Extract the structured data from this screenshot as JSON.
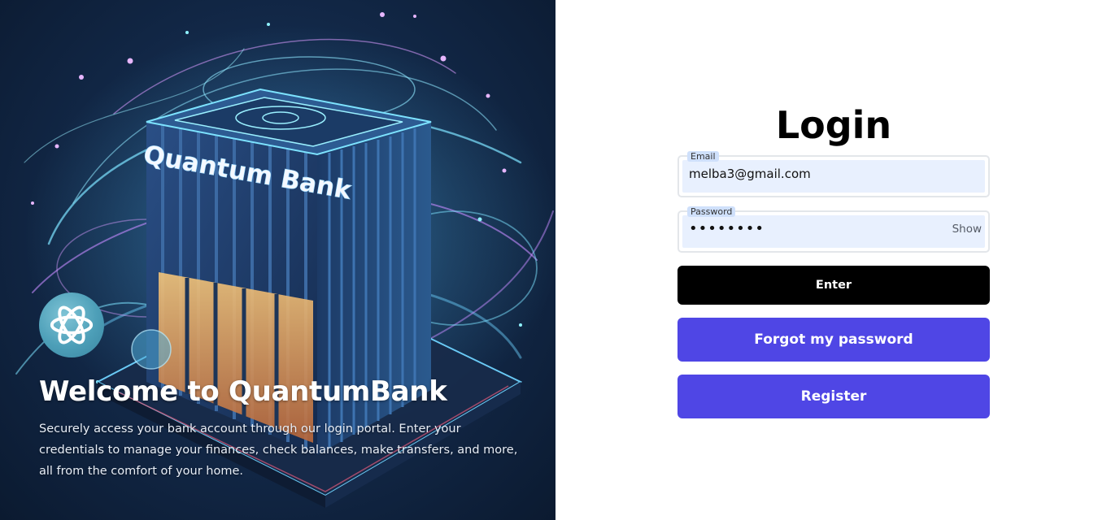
{
  "hero": {
    "building_sign": "Quantum Bank",
    "logo_icon": "atom-orbit-icon",
    "title": "Welcome to QuantumBank",
    "description": "Securely access your bank account through our login portal. Enter your credentials to manage your finances, check balances, make transfers, and more, all from the comfort of your home."
  },
  "login": {
    "title": "Login",
    "email": {
      "label": "Email",
      "value": "melba3@gmail.com"
    },
    "password": {
      "label": "Password",
      "value": "••••••••",
      "toggle_label": "Show"
    },
    "enter_label": "Enter",
    "forgot_label": "Forgot my password",
    "register_label": "Register"
  },
  "colors": {
    "primary_button": "#000000",
    "accent_button": "#4f46e5",
    "field_fill": "#e8f0fe"
  }
}
